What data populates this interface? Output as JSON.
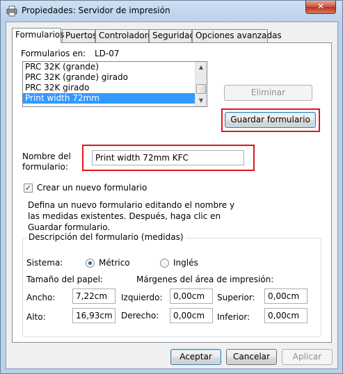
{
  "window": {
    "title": "Propiedades: Servidor de impresión",
    "close_glyph": "✕"
  },
  "tabs": [
    "Formularios",
    "Puertos",
    "Controladores",
    "Seguridad",
    "Opciones avanzadas"
  ],
  "forms_section": {
    "label": "Formularios en:",
    "server": "LD-07",
    "list_items": [
      "PRC 32K (grande)",
      "PRC 32K (grande) girado",
      "PRC 32K girado",
      "Print width 72mm"
    ],
    "selected_item": "Print width 72mm"
  },
  "buttons": {
    "delete": "Eliminar",
    "save_form": "Guardar formulario",
    "accept": "Aceptar",
    "cancel": "Cancelar",
    "apply": "Aplicar"
  },
  "form_name": {
    "label_line1": "Nombre del",
    "label_line2": "formulario:",
    "value": "Print width 72mm KFC"
  },
  "create_new": {
    "label": "Crear un nuevo formulario",
    "checked": true
  },
  "description": "Defina un nuevo formulario editando el nombre y las medidas existentes. Después, haga clic en Guardar formulario.",
  "measurements": {
    "group_title": "Descripción del formulario (medidas)",
    "system_label": "Sistema:",
    "metric_label": "Métrico",
    "english_label": "Inglés",
    "selected_system": "Métrico",
    "paper_size_label": "Tamaño del papel:",
    "margins_label": "Márgenes del área de impresión:",
    "width_label": "Ancho:",
    "width_value": "7,22cm",
    "height_label": "Alto:",
    "height_value": "16,93cm",
    "left_label": "Izquierdo:",
    "left_value": "0,00cm",
    "right_label": "Derecho:",
    "right_value": "0,00cm",
    "top_label": "Superior:",
    "top_value": "0,00cm",
    "bottom_label": "Inferior:",
    "bottom_value": "0,00cm"
  },
  "icons": {
    "app": "printer-icon",
    "check": "check-icon",
    "scroll_up": "scroll-up-arrow-icon",
    "scroll_down": "scroll-down-arrow-icon"
  },
  "colors": {
    "highlight": "#e0141c",
    "selection": "#3399ff",
    "close_button": "#c9503a"
  }
}
